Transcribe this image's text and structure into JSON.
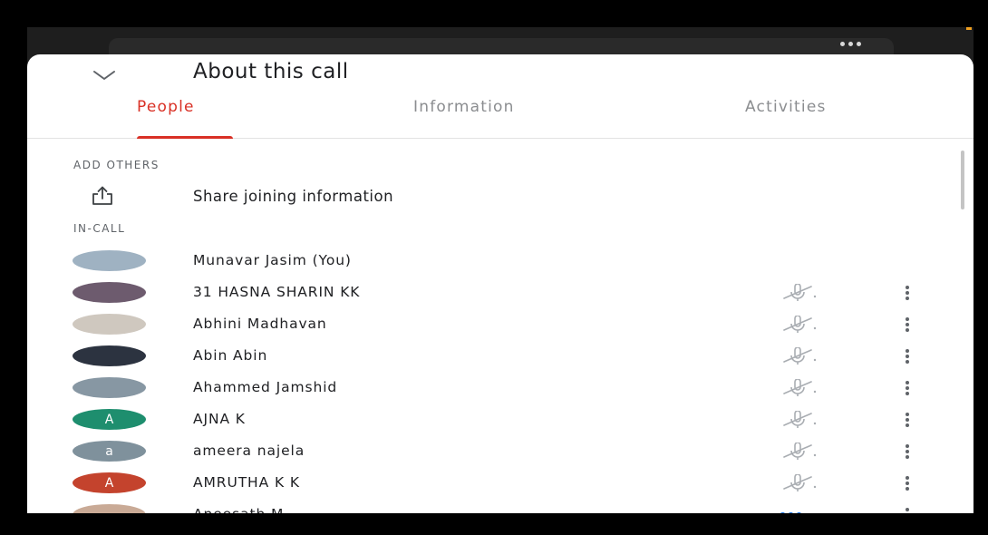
{
  "colors": {
    "accent": "#d93025",
    "speaking": "#1a73e8"
  },
  "header": {
    "title": "About this call",
    "collapse_icon": "chevron-down-icon"
  },
  "tabs": [
    {
      "label": "People",
      "active": true
    },
    {
      "label": "Information",
      "active": false
    },
    {
      "label": "Activities",
      "active": false
    }
  ],
  "add_others": {
    "heading": "ADD OTHERS",
    "share_label": "Share joining information",
    "share_icon": "share-icon"
  },
  "in_call": {
    "heading": "IN-CALL",
    "people": [
      {
        "name": "Munavar Jasim (You)",
        "avatar": "photo",
        "avatar_color": "#9fb2c2",
        "mic": "none"
      },
      {
        "name": "31 HASNA SHARIN KK",
        "avatar": "photo",
        "avatar_color": "#6d5b6e",
        "mic": "muted"
      },
      {
        "name": "Abhini Madhavan",
        "avatar": "photo",
        "avatar_color": "#cfc8bf",
        "mic": "muted"
      },
      {
        "name": "Abin Abin",
        "avatar": "photo",
        "avatar_color": "#2c3340",
        "mic": "muted"
      },
      {
        "name": "Ahammed Jamshid",
        "avatar": "photo",
        "avatar_color": "#8797a3",
        "mic": "muted"
      },
      {
        "name": "AJNA K",
        "avatar": "A",
        "avatar_color": "#1e8e6e",
        "mic": "muted"
      },
      {
        "name": "ameera najela",
        "avatar": "a",
        "avatar_color": "#7f919c",
        "mic": "muted"
      },
      {
        "name": "AMRUTHA K K",
        "avatar": "A",
        "avatar_color": "#c4432d",
        "mic": "muted"
      },
      {
        "name": "Aneesath M",
        "avatar": "photo",
        "avatar_color": "#c9aa96",
        "mic": "speaking"
      },
      {
        "name": "",
        "avatar": "",
        "avatar_color": "#e8497a",
        "mic": "muted"
      }
    ]
  }
}
